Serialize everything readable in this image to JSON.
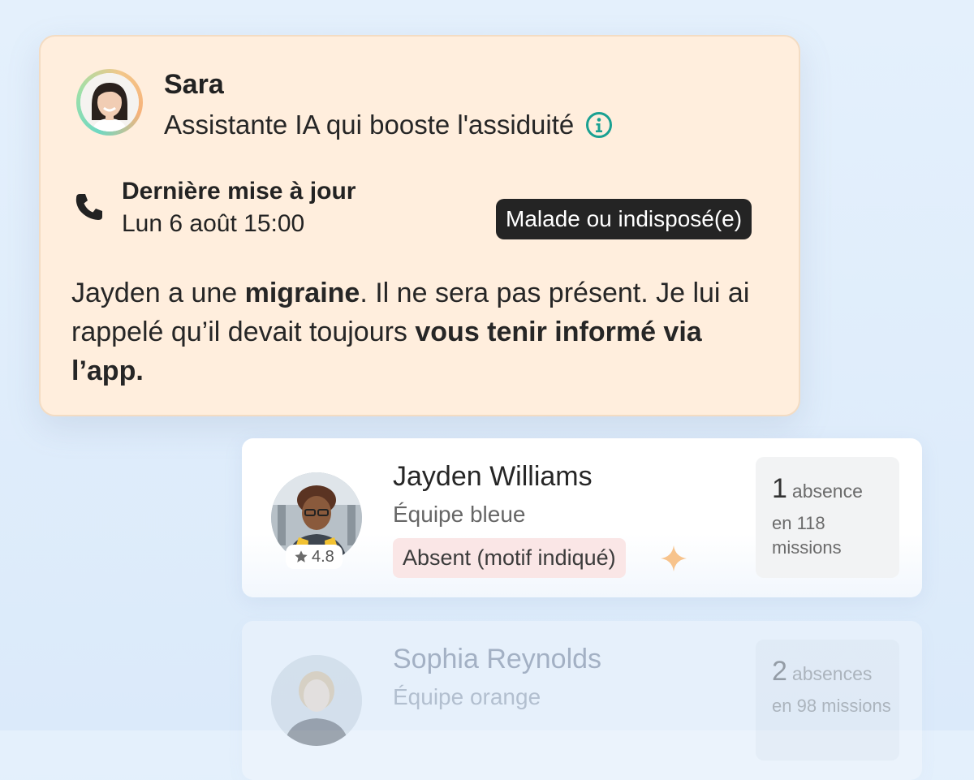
{
  "assistant": {
    "name": "Sara",
    "role": "Assistante IA qui booste l'assiduité",
    "icons": {
      "info": "info-icon",
      "phone": "phone-icon"
    },
    "colors": {
      "card": "#ffeedd",
      "accent": "#1aa192"
    }
  },
  "update": {
    "title": "Dernière mise à jour",
    "time": "Lun 6 août 15:00",
    "reason": "Malade ou indisposé(e)"
  },
  "message": {
    "part1": "Jayden a une ",
    "bold1": "migraine",
    "part2": ". Il ne sera pas présent. Je lui ai rappelé qu’il devait toujours ",
    "bold2": "vous tenir informé via l’app."
  },
  "workers": [
    {
      "name": "Jayden Williams",
      "team": "Équipe bleue",
      "rating": "4.8",
      "status": "Absent (motif indiqué)",
      "absence_count": "1",
      "absence_unit": "absence",
      "missions": "en 118 missions",
      "icons": {
        "rating": "star-icon",
        "status": "sparkle-icon"
      }
    },
    {
      "name": "Sophia Reynolds",
      "team": "Équipe orange",
      "absence_count": "2",
      "absence_unit": "absences",
      "missions": "en 98 missions"
    }
  ]
}
